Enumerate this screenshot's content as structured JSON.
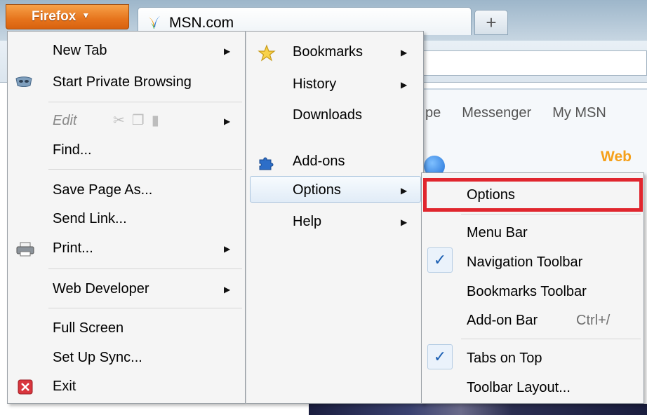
{
  "browser": {
    "app_button_label": "Firefox",
    "tab_title": "MSN.com",
    "new_tab_symbol": "+"
  },
  "page": {
    "links": [
      "pe",
      "Messenger",
      "My MSN"
    ],
    "web_tab": "Web"
  },
  "main_menu": {
    "items": [
      {
        "label": "New Tab",
        "submenu": true
      },
      {
        "label": "Start Private Browsing",
        "icon": "private-browsing-mask-icon"
      },
      {
        "label": "Edit",
        "submenu": true,
        "disabled": true,
        "tools": [
          "cut-icon",
          "copy-icon",
          "paste-icon"
        ]
      },
      {
        "label": "Find..."
      },
      {
        "label": "Save Page As..."
      },
      {
        "label": "Send Link..."
      },
      {
        "label": "Print...",
        "submenu": true,
        "icon": "printer-icon"
      },
      {
        "label": "Web Developer",
        "submenu": true
      },
      {
        "label": "Full Screen"
      },
      {
        "label": "Set Up Sync..."
      },
      {
        "label": "Exit",
        "icon": "exit-icon"
      }
    ]
  },
  "sub_menu": {
    "items": [
      {
        "label": "Bookmarks",
        "submenu": true,
        "icon": "star-icon"
      },
      {
        "label": "History",
        "submenu": true
      },
      {
        "label": "Downloads"
      },
      {
        "label": "Add-ons",
        "icon": "puzzle-piece-icon"
      },
      {
        "label": "Options",
        "submenu": true,
        "selected": true
      },
      {
        "label": "Help",
        "submenu": true
      }
    ]
  },
  "options_menu": {
    "items": [
      {
        "label": "Options",
        "highlighted": true
      },
      {
        "label": "Menu Bar",
        "checked": false
      },
      {
        "label": "Navigation Toolbar",
        "checked": true
      },
      {
        "label": "Bookmarks Toolbar",
        "checked": false
      },
      {
        "label": "Add-on Bar",
        "shortcut": "Ctrl+/",
        "checked": false
      },
      {
        "label": "Tabs on Top",
        "checked": true
      },
      {
        "label": "Toolbar Layout..."
      }
    ],
    "check_symbol": "✓"
  },
  "colors": {
    "firefox_orange": "#e6741c",
    "highlight_red": "#e0262e",
    "check_blue": "#1b5fb3"
  }
}
